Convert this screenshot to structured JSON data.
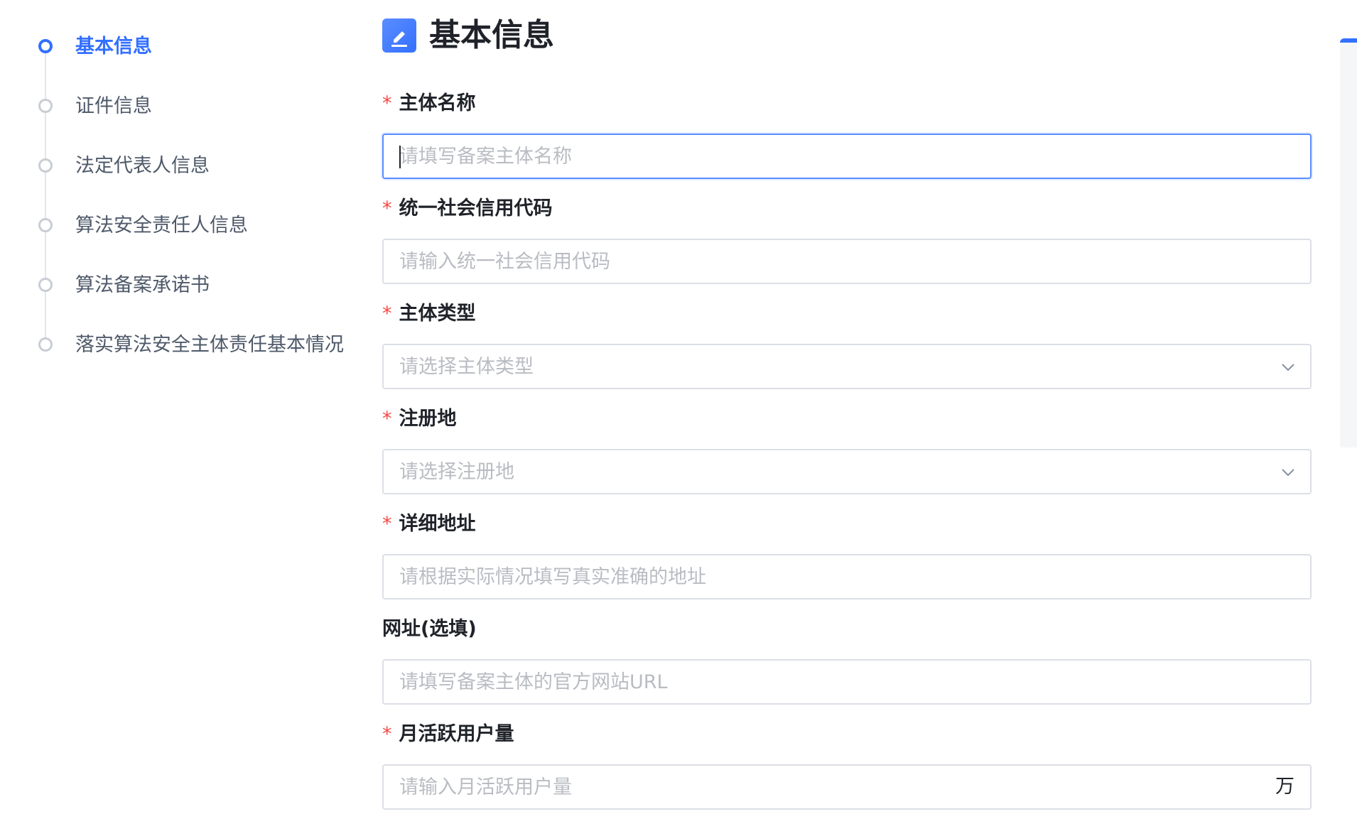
{
  "steps": [
    {
      "label": "基本信息",
      "active": true
    },
    {
      "label": "证件信息",
      "active": false
    },
    {
      "label": "法定代表人信息",
      "active": false
    },
    {
      "label": "算法安全责任人信息",
      "active": false
    },
    {
      "label": "算法备案承诺书",
      "active": false
    },
    {
      "label": "落实算法安全主体责任基本情况",
      "active": false
    }
  ],
  "section": {
    "title": "基本信息",
    "icon": "edit-icon"
  },
  "form": {
    "required_mark": "*",
    "entity_name": {
      "label": "主体名称",
      "placeholder": "请填写备案主体名称",
      "value": ""
    },
    "credit_code": {
      "label": "统一社会信用代码",
      "placeholder": "请输入统一社会信用代码",
      "value": ""
    },
    "entity_type": {
      "label": "主体类型",
      "placeholder": "请选择主体类型"
    },
    "registered_place": {
      "label": "注册地",
      "placeholder": "请选择注册地"
    },
    "address": {
      "label": "详细地址",
      "placeholder": "请根据实际情况填写真实准确的地址",
      "value": ""
    },
    "website": {
      "label": "网址(选填)",
      "placeholder": "请填写备案主体的官方网站URL",
      "value": ""
    },
    "mau": {
      "label": "月活跃用户量",
      "placeholder": "请输入月活跃用户量",
      "value": "",
      "suffix": "万"
    }
  },
  "colors": {
    "accent": "#3370ff",
    "required": "#f54a45",
    "border": "#dcdfe6",
    "placeholder": "#b9bcc2"
  }
}
